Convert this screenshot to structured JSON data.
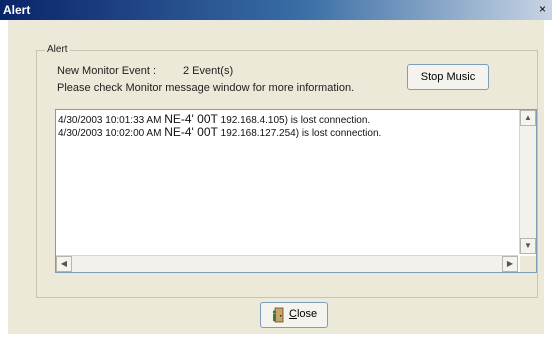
{
  "window": {
    "title": "Alert",
    "close_glyph": "×"
  },
  "group": {
    "label": "Alert"
  },
  "info": {
    "events_label": "New Monitor Event :",
    "events_count": "2 Event(s)",
    "message": "Please check Monitor message window for more information."
  },
  "buttons": {
    "stop_music": "Stop Music",
    "close_mnemonic": "C",
    "close_rest": "lose"
  },
  "log": [
    {
      "timestamp": "4/30/2003 10:01:33 AM",
      "ne": "NE-4' 00T",
      "rest": "192.168.4.105) is lost connection."
    },
    {
      "timestamp": "4/30/2003 10:02:00 AM",
      "ne": "NE-4' 00T",
      "rest": "192.168.127.254) is lost connection."
    }
  ],
  "icons": {
    "close_button": "door-exit-icon",
    "scroll_up": "arrow-up-icon",
    "scroll_down": "arrow-down-icon",
    "scroll_left": "arrow-left-icon",
    "scroll_right": "arrow-right-icon"
  }
}
